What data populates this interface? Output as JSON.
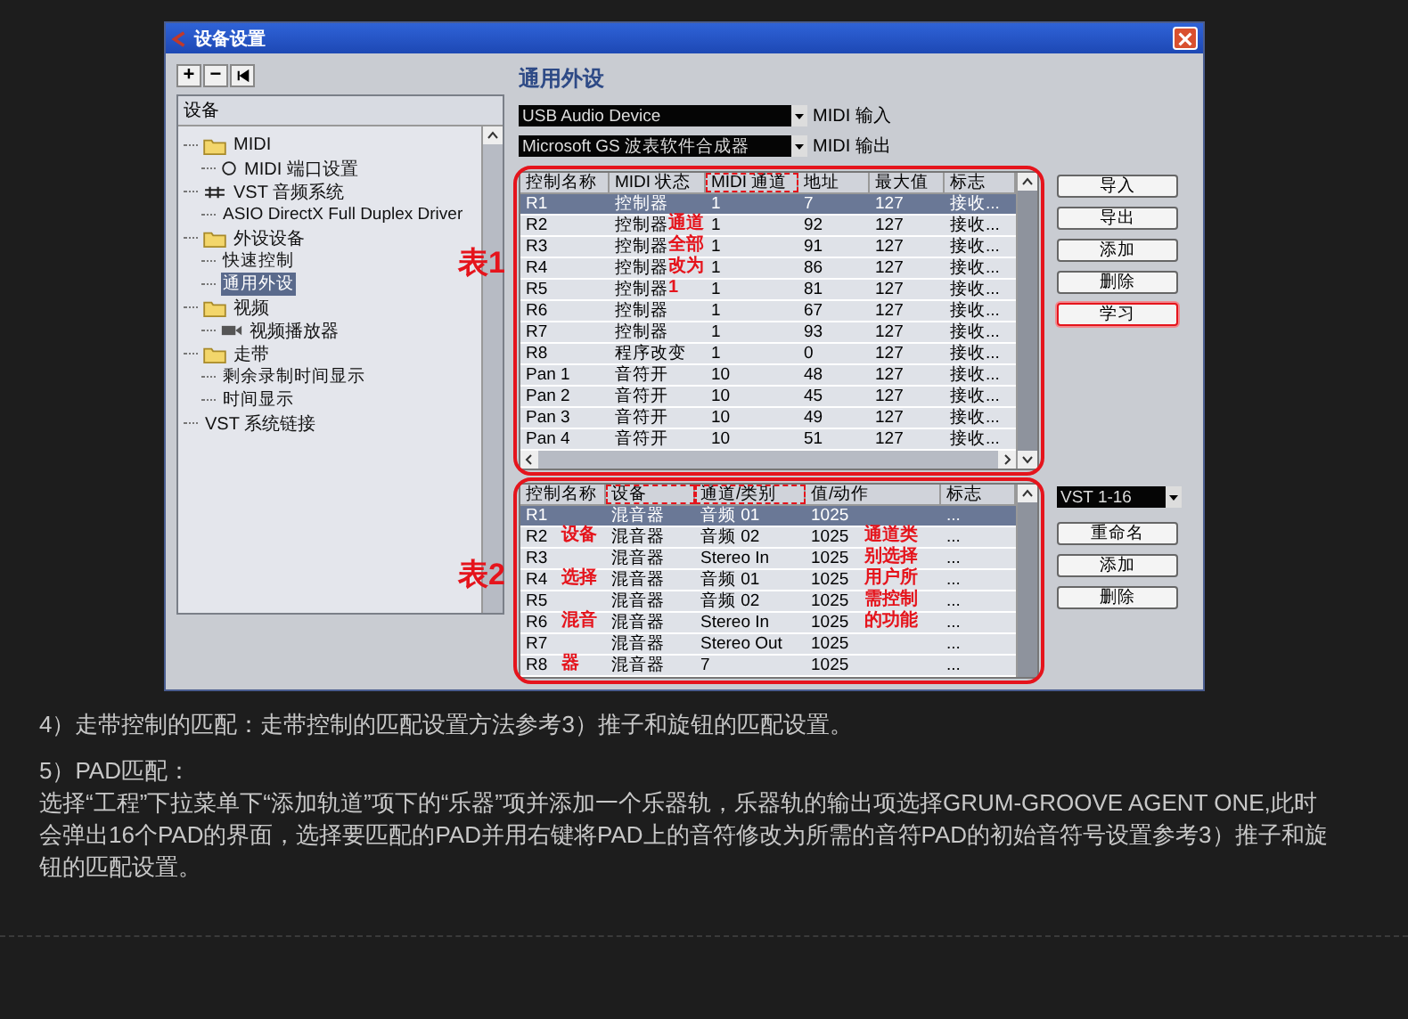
{
  "window": {
    "title": "设备设置"
  },
  "tree_toolbar": {
    "buttons": [
      {
        "kind": "text",
        "label": "+"
      },
      {
        "kind": "text",
        "label": "−"
      },
      {
        "kind": "icon"
      }
    ]
  },
  "tree": {
    "header": "设备",
    "items": [
      {
        "label": "MIDI",
        "kind": "folder",
        "selected": false,
        "children": [
          {
            "label": "MIDI 端口设置",
            "kind": "port",
            "selected": false
          }
        ]
      },
      {
        "label": "VST 音频系统",
        "kind": "audio",
        "selected": false,
        "children": [
          {
            "label": "ASIO DirectX Full Duplex Driver",
            "kind": "plain",
            "selected": false
          }
        ]
      },
      {
        "label": "外设设备",
        "kind": "folder",
        "selected": false,
        "children": [
          {
            "label": "快速控制",
            "kind": "plain",
            "selected": false
          },
          {
            "label": "通用外设",
            "kind": "plain",
            "selected": true
          }
        ]
      },
      {
        "label": "视频",
        "kind": "folder",
        "selected": false,
        "children": [
          {
            "label": "视频播放器",
            "kind": "video",
            "selected": false
          }
        ]
      },
      {
        "label": "走带",
        "kind": "folder",
        "selected": false,
        "children": [
          {
            "label": "剩余录制时间显示",
            "kind": "plain",
            "selected": false
          },
          {
            "label": "时间显示",
            "kind": "plain",
            "selected": false
          }
        ]
      },
      {
        "label": "VST 系统链接",
        "kind": "plain",
        "selected": false
      }
    ]
  },
  "panel_title": "通用外设",
  "midi_input": {
    "value": "USB Audio Device",
    "label": "MIDI 输入"
  },
  "midi_output": {
    "value": "Microsoft GS 波表软件合成器",
    "label": "MIDI 输出"
  },
  "table_1": {
    "label": "表1",
    "columns": [
      {
        "label": "控制名称",
        "circled": false
      },
      {
        "label": "MIDI 状态",
        "circled": false
      },
      {
        "label": "MIDI 通道",
        "circled": true
      },
      {
        "label": "地址",
        "circled": false
      },
      {
        "label": "最大值",
        "circled": false
      },
      {
        "label": "标志",
        "circled": false
      }
    ],
    "rows": [
      {
        "cells": [
          "R1",
          "控制器",
          "1",
          "7",
          "127",
          "接收..."
        ],
        "selected": true
      },
      {
        "cells": [
          "R2",
          "控制器",
          "1",
          "92",
          "127",
          "接收..."
        ],
        "selected": false
      },
      {
        "cells": [
          "R3",
          "控制器",
          "1",
          "91",
          "127",
          "接收..."
        ],
        "selected": false
      },
      {
        "cells": [
          "R4",
          "控制器",
          "1",
          "86",
          "127",
          "接收..."
        ],
        "selected": false
      },
      {
        "cells": [
          "R5",
          "控制器",
          "1",
          "81",
          "127",
          "接收..."
        ],
        "selected": false
      },
      {
        "cells": [
          "R6",
          "控制器",
          "1",
          "67",
          "127",
          "接收..."
        ],
        "selected": false
      },
      {
        "cells": [
          "R7",
          "控制器",
          "1",
          "93",
          "127",
          "接收..."
        ],
        "selected": false
      },
      {
        "cells": [
          "R8",
          "程序改变",
          "1",
          "0",
          "127",
          "接收..."
        ],
        "selected": false
      },
      {
        "cells": [
          "Pan 1",
          "音符开",
          "10",
          "48",
          "127",
          "接收..."
        ],
        "selected": false
      },
      {
        "cells": [
          "Pan 2",
          "音符开",
          "10",
          "45",
          "127",
          "接收..."
        ],
        "selected": false
      },
      {
        "cells": [
          "Pan 3",
          "音符开",
          "10",
          "49",
          "127",
          "接收..."
        ],
        "selected": false
      },
      {
        "cells": [
          "Pan 4",
          "音符开",
          "10",
          "51",
          "127",
          "接收..."
        ],
        "selected": false
      }
    ],
    "notes": [
      {
        "lines": [
          "通道",
          "全部",
          "改为",
          "1"
        ]
      }
    ]
  },
  "buttons_1": [
    {
      "label": "导入",
      "circled": false
    },
    {
      "label": "导出",
      "circled": false
    },
    {
      "label": "添加",
      "circled": false
    },
    {
      "label": "删除",
      "circled": false
    },
    {
      "label": "学习",
      "circled": true
    }
  ],
  "table_2": {
    "label": "表2",
    "columns": [
      {
        "label": "控制名称",
        "circled": false
      },
      {
        "label": "设备",
        "circled": true
      },
      {
        "label": "通道/类别",
        "circled": true
      },
      {
        "label": "值/动作",
        "circled": false
      },
      {
        "label": "标志",
        "circled": false
      }
    ],
    "rows": [
      {
        "cells": [
          "R1",
          "混音器",
          "音频 01",
          "1025",
          "..."
        ],
        "selected": true
      },
      {
        "cells": [
          "R2",
          "混音器",
          "音频 02",
          "1025",
          "..."
        ],
        "selected": false
      },
      {
        "cells": [
          "R3",
          "混音器",
          "Stereo In",
          "1025",
          "..."
        ],
        "selected": false
      },
      {
        "cells": [
          "R4",
          "混音器",
          "音频 01",
          "1025",
          "..."
        ],
        "selected": false
      },
      {
        "cells": [
          "R5",
          "混音器",
          "音频 02",
          "1025",
          "..."
        ],
        "selected": false
      },
      {
        "cells": [
          "R6",
          "混音器",
          "Stereo In",
          "1025",
          "..."
        ],
        "selected": false
      },
      {
        "cells": [
          "R7",
          "混音器",
          "Stereo Out",
          "1025",
          "..."
        ],
        "selected": false
      },
      {
        "cells": [
          "R8",
          "混音器",
          "7",
          "1025",
          "..."
        ],
        "selected": false
      }
    ],
    "notes": [
      {
        "lines": [
          "设备",
          "选择",
          "混音",
          "器"
        ]
      },
      {
        "lines": [
          "通道类",
          "别选择",
          "用户所",
          "需控制",
          "的功能"
        ]
      }
    ]
  },
  "vst_select": {
    "value": "VST 1-16"
  },
  "buttons_2": [
    {
      "label": "重命名",
      "circled": false
    },
    {
      "label": "添加",
      "circled": false
    },
    {
      "label": "删除",
      "circled": false
    }
  ],
  "article": {
    "paragraphs": [
      "4）走带控制的匹配：走带控制的匹配设置方法参考3）推子和旋钮的匹配设置。",
      "5）PAD匹配：",
      "选择“工程”下拉菜单下“添加轨道”项下的“乐器”项并添加一个乐器轨，乐器轨的输出项选择GRUM-GROOVE AGENT ONE,此时会弹出16个PAD的界面，选择要匹配的PAD并用右键将PAD上的音符修改为所需的音符PAD的初始音符号设置参考3）推子和旋钮的匹配设置。"
    ]
  }
}
